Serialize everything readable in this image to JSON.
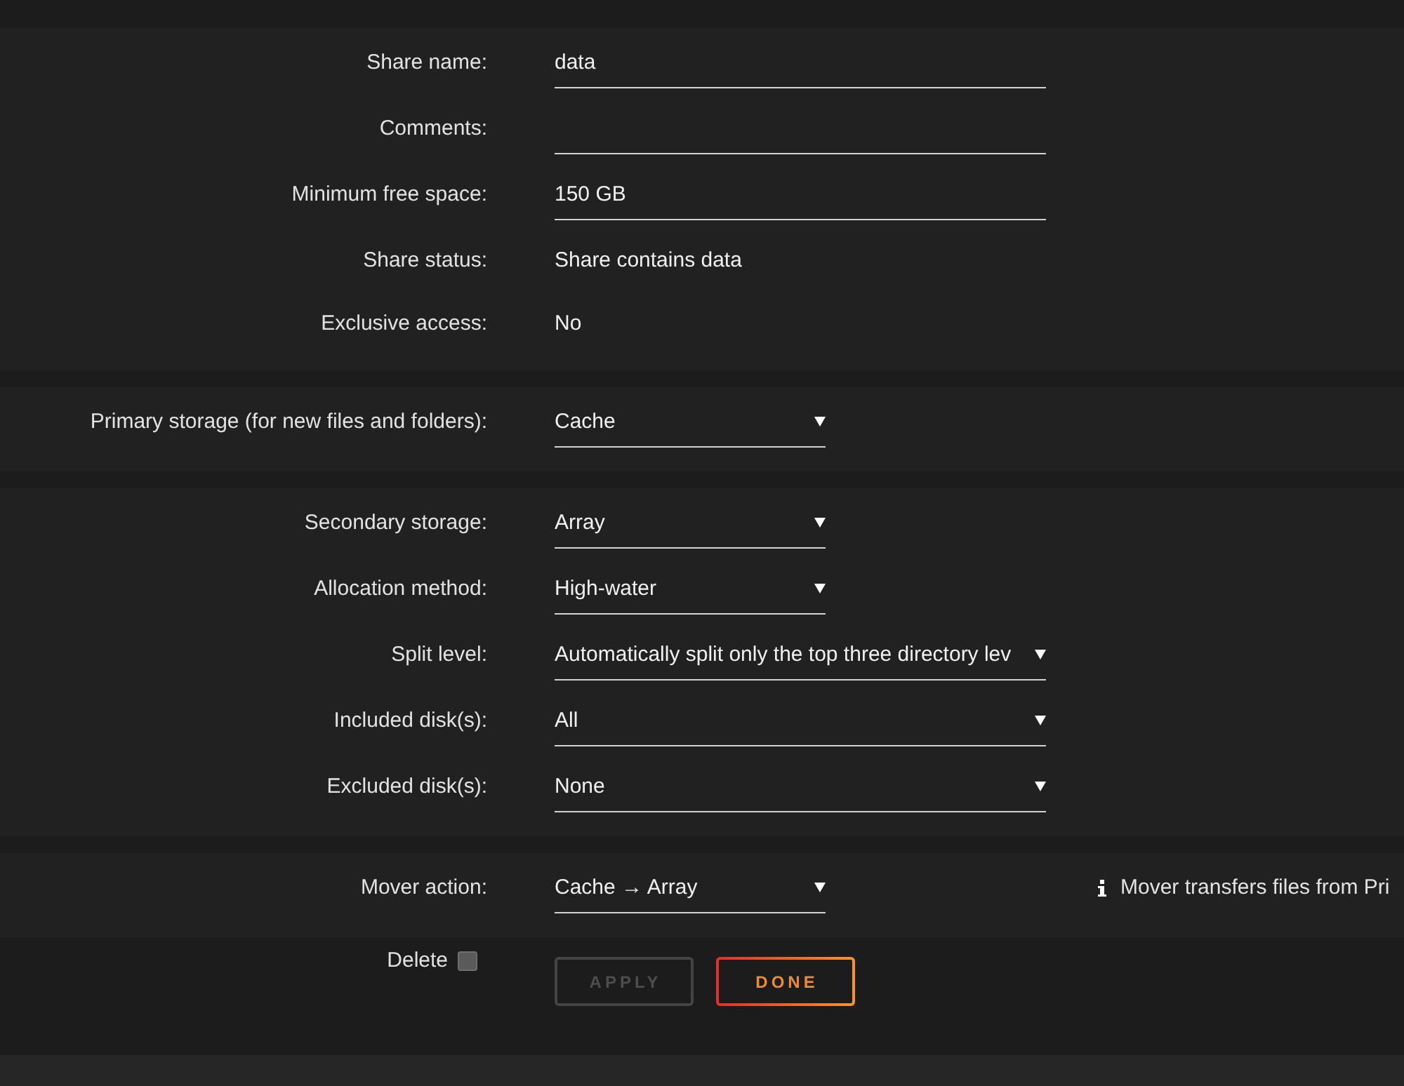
{
  "sections": [
    {
      "rows": [
        {
          "label": "Share name:",
          "kind": "input",
          "value": "data"
        },
        {
          "label": "Comments:",
          "kind": "input"
        },
        {
          "label": "Minimum free space:",
          "kind": "input",
          "value": "150 GB"
        },
        {
          "label": "Share status:",
          "kind": "text",
          "value": "Share contains data"
        },
        {
          "label": "Exclusive access:",
          "kind": "text",
          "value": "No"
        }
      ]
    },
    {
      "rows": [
        {
          "label": "Primary storage (for new files and folders):",
          "kind": "select",
          "value": "Cache"
        }
      ]
    },
    {
      "rows": [
        {
          "label": "Secondary storage:",
          "kind": "select",
          "value": "Array"
        },
        {
          "label": "Allocation method:",
          "kind": "select",
          "value": "High-water"
        },
        {
          "label": "Split level:",
          "kind": "wideselect",
          "value": "Automatically split only the top three directory lev"
        },
        {
          "label": "Included disk(s):",
          "kind": "wideselect",
          "value": "All"
        },
        {
          "label": "Excluded disk(s):",
          "kind": "wideselect",
          "value": "None"
        }
      ]
    },
    {
      "rows": [
        {
          "label": "Mover action:",
          "kind": "select",
          "value": "Cache → Array",
          "note": "Mover transfers files from Pri"
        }
      ]
    }
  ],
  "footer": {
    "delete": {
      "label": "Delete",
      "checked": false
    },
    "buttons": [
      {
        "label": "APPLY",
        "disabled": true
      },
      {
        "label": "DONE",
        "disabled": false
      }
    ]
  }
}
